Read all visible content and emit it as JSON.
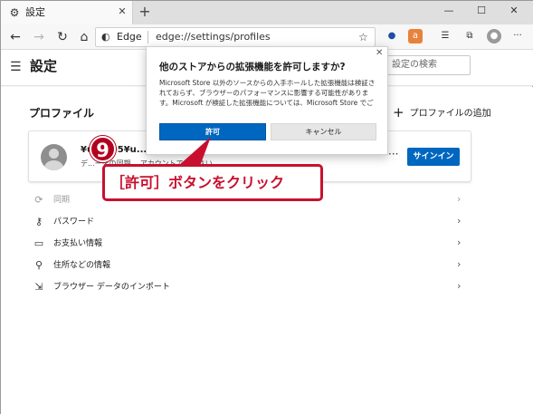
{
  "window": {
    "tab_title": "設定",
    "tab_icon": "gear-icon",
    "tab_close": "✕",
    "new_tab": "+",
    "minimize": "—",
    "maximize": "☐",
    "close": "✕"
  },
  "navbar": {
    "url_label": "Edge",
    "url": "edge://settings/profiles",
    "back_icon": "back-arrow-icon",
    "forward_icon": "forward-arrow-icon",
    "refresh_icon": "refresh-icon",
    "home_icon": "home-icon"
  },
  "settings": {
    "title": "設定",
    "search_placeholder": "設定の検索",
    "profile_heading": "プロファイル",
    "add_profile_label": "プロファイルの追加",
    "add_profile_plus": "+",
    "profile_name": "¥u...0D5¥u...d...",
    "profile_sub": "デ...ーをの同期 ...アカウントでください",
    "more_dots": "···",
    "signin_label": "サインイン",
    "menu_items": [
      {
        "label": "同期",
        "icon": "sync-icon",
        "enabled": false
      },
      {
        "label": "パスワード",
        "icon": "key-icon",
        "enabled": true
      },
      {
        "label": "お支払い情報",
        "icon": "credit-card-icon",
        "enabled": true
      },
      {
        "label": "住所などの情報",
        "icon": "location-pin-icon",
        "enabled": true
      },
      {
        "label": "ブラウザー データのインポート",
        "icon": "import-icon",
        "enabled": true
      }
    ]
  },
  "dialog": {
    "title": "他のストアからの拡張機能を許可しますか?",
    "body": "Microsoft Store 以外のソースからの入手ホールした拡張機能は検証されておらず、ブラウザーのパフォーマンスに影響する可能性があります。Microsoft が検証した拡張機能については、Microsoft Store でご確認ください。",
    "allow_label": "許可",
    "cancel_label": "キャンセル",
    "close": "✕"
  },
  "annotation": {
    "step_number": "9",
    "callout_text": "［許可］ボタンをクリック",
    "accent_color": "#c8102e"
  }
}
